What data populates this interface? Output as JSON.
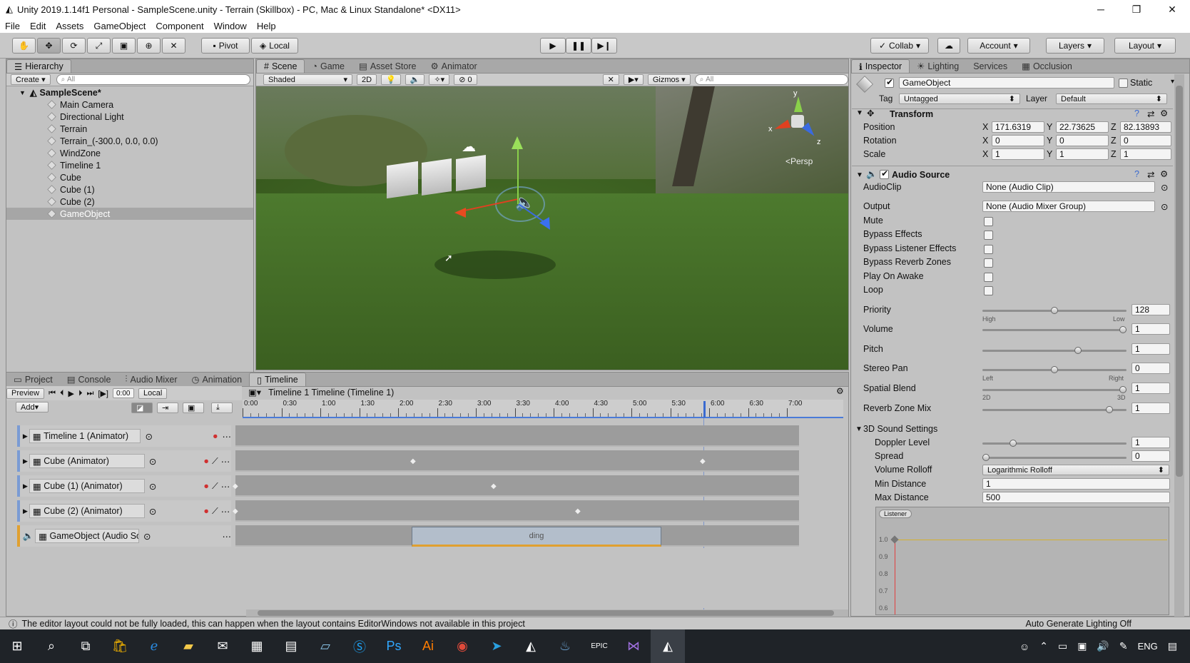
{
  "window": {
    "title": "Unity 2019.1.14f1 Personal - SampleScene.unity - Terrain (Skillbox) - PC, Mac & Linux Standalone* <DX11>"
  },
  "menu": [
    "File",
    "Edit",
    "Assets",
    "GameObject",
    "Component",
    "Window",
    "Help"
  ],
  "toolbar": {
    "pivot": "Pivot",
    "local": "Local",
    "collab": "Collab",
    "account": "Account",
    "layers": "Layers",
    "layout": "Layout"
  },
  "hierarchy": {
    "tab": "Hierarchy",
    "create": "Create",
    "search_placeholder": "All",
    "scene": "SampleScene*",
    "items": [
      "Main Camera",
      "Directional Light",
      "Terrain",
      "Terrain_(-300.0, 0.0, 0.0)",
      "WindZone",
      "Timeline 1",
      "Cube",
      "Cube (1)",
      "Cube (2)",
      "GameObject"
    ],
    "selected": "GameObject"
  },
  "scene_view": {
    "tabs": [
      "Scene",
      "Game",
      "Asset Store",
      "Animator"
    ],
    "shading": "Shaded",
    "mode_2d": "2D",
    "gizmos": "Gizmos",
    "search_placeholder": "All",
    "fx_count": "0",
    "persp": "<Persp",
    "axes": {
      "x": "x",
      "y": "y",
      "z": "z"
    }
  },
  "inspector": {
    "tabs": [
      "Inspector",
      "Lighting",
      "Services",
      "Occlusion"
    ],
    "object_name": "GameObject",
    "static": "Static",
    "tag_label": "Tag",
    "tag": "Untagged",
    "layer_label": "Layer",
    "layer": "Default",
    "transform": {
      "title": "Transform",
      "position_label": "Position",
      "rotation_label": "Rotation",
      "scale_label": "Scale",
      "position": [
        "171.6319",
        "22.73625",
        "82.13893"
      ],
      "rotation": [
        "0",
        "0",
        "0"
      ],
      "scale": [
        "1",
        "1",
        "1"
      ],
      "axis": [
        "X",
        "Y",
        "Z"
      ]
    },
    "audio": {
      "title": "Audio Source",
      "audioclip_label": "AudioClip",
      "audioclip": "None (Audio Clip)",
      "output_label": "Output",
      "output": "None (Audio Mixer Group)",
      "checks": [
        "Mute",
        "Bypass Effects",
        "Bypass Listener Effects",
        "Bypass Reverb Zones",
        "Play On Awake",
        "Loop"
      ],
      "priority_label": "Priority",
      "priority": "128",
      "priority_level": 0.5,
      "priority_low": "High",
      "priority_high": "Low",
      "volume_label": "Volume",
      "volume": "1",
      "volume_level": 1.0,
      "pitch_label": "Pitch",
      "pitch": "1",
      "pitch_level": 0.67,
      "stereo_label": "Stereo Pan",
      "stereo": "0",
      "stereo_level": 0.5,
      "stereo_left": "Left",
      "stereo_right": "Right",
      "spatial_label": "Spatial Blend",
      "spatial": "1",
      "spatial_level": 1.0,
      "spatial_2d": "2D",
      "spatial_3d": "3D",
      "reverb_label": "Reverb Zone Mix",
      "reverb": "1",
      "reverb_level": 0.9,
      "sound3d_title": "3D Sound Settings",
      "doppler_label": "Doppler Level",
      "doppler": "1",
      "doppler_level": 0.2,
      "spread_label": "Spread",
      "spread": "0",
      "spread_level": 0.0,
      "rolloff_label": "Volume Rolloff",
      "rolloff": "Logarithmic Rolloff",
      "min_label": "Min Distance",
      "min": "1",
      "max_label": "Max Distance",
      "max": "500",
      "graph_badge": "Listener",
      "graph_ticks": [
        "1.0",
        "0.9",
        "0.8",
        "0.7",
        "0.6"
      ]
    }
  },
  "bottom": {
    "tabs": [
      "Project",
      "Console",
      "Audio Mixer",
      "Animation",
      "Timeline"
    ],
    "preview": "Preview",
    "time": "0:00",
    "local": "Local",
    "add": "Add",
    "timeline_title": "Timeline 1 Timeline (Timeline 1)",
    "ruler": [
      "0:00",
      "0:30",
      "1:00",
      "1:30",
      "2:00",
      "2:30",
      "3:00",
      "3:30",
      "4:00",
      "4:30",
      "5:00",
      "5:30",
      "6:00",
      "6:30",
      "7:00"
    ],
    "tracks": [
      "Timeline 1 (Animator)",
      "Cube (Animator)",
      "Cube (1) (Animator)",
      "Cube (2) (Animator)",
      "GameObject (Audio So"
    ],
    "clip": "ding"
  },
  "status": {
    "message": "The editor layout could not be fully loaded, this can happen when the layout contains EditorWindows not available in this project",
    "right": "Auto Generate Lighting Off"
  },
  "taskbar": {
    "lang": "ENG"
  }
}
